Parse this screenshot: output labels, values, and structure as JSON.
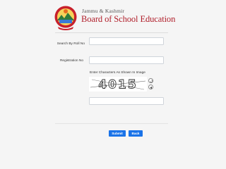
{
  "header": {
    "org_line": "Jammu & Kashmir",
    "title": "Board of School Education"
  },
  "form": {
    "roll_label": "Search By Roll No",
    "roll_value": "",
    "registration_label": "Registration No",
    "registration_value": "",
    "captcha_label": "Enter Characters As Shown In Image",
    "captcha_text": "4015",
    "captcha_value": ""
  },
  "buttons": {
    "submit": "Submit",
    "back": "Back"
  },
  "icons": {
    "refresh": "refresh-icon",
    "audio": "audio-icon"
  },
  "colors": {
    "brand": "#b01e2a",
    "button": "#1a73e8"
  }
}
